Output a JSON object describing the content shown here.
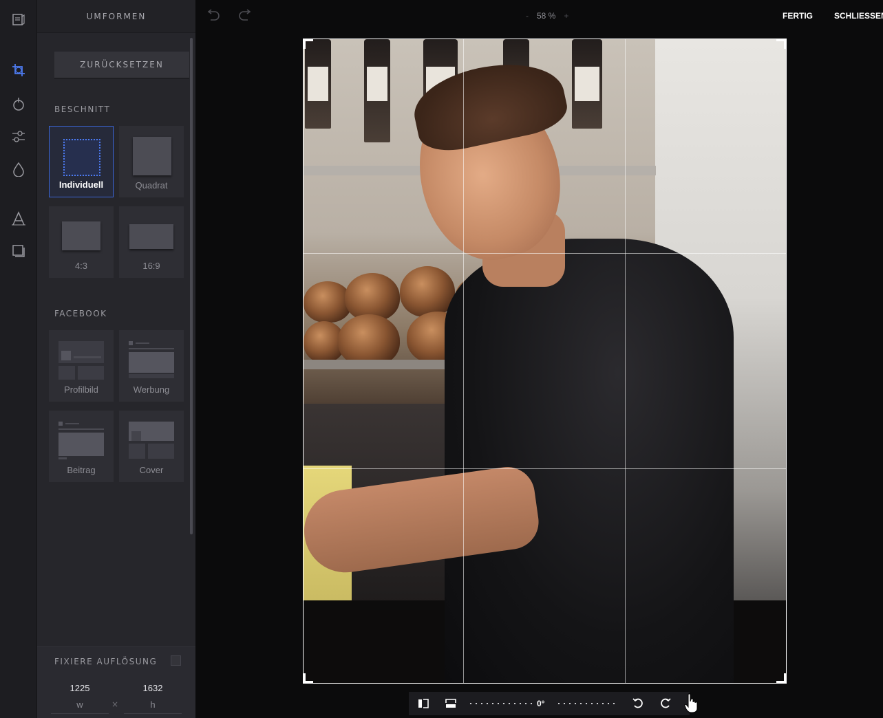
{
  "rail": {
    "icons": [
      "library-icon",
      "crop-icon",
      "filter-icon",
      "adjust-icon",
      "drop-icon",
      "text-icon",
      "frame-icon"
    ]
  },
  "panel": {
    "title": "UMFORMEN",
    "reset_label": "ZURÜCKSETZEN",
    "crop_section": "BESCHNITT",
    "crop_presets": [
      {
        "label": "Individuell",
        "selected": true
      },
      {
        "label": "Quadrat"
      },
      {
        "label": "4:3"
      },
      {
        "label": "16:9"
      }
    ],
    "facebook_section": "FACEBOOK",
    "facebook_presets": [
      {
        "label": "Profilbild"
      },
      {
        "label": "Werbung"
      },
      {
        "label": "Beitrag"
      },
      {
        "label": "Cover"
      }
    ],
    "fix_resolution_label": "FIXIERE AUFLÖSUNG",
    "fix_resolution_checked": false,
    "width_value": "1225",
    "width_unit": "w",
    "height_value": "1632",
    "height_unit": "h",
    "times_symbol": "×"
  },
  "topbar": {
    "zoom_minus": "-",
    "zoom_value": "58 %",
    "zoom_plus": "+",
    "done_label": "FERTIG",
    "close_label": "SCHLIESSEN"
  },
  "bottombar": {
    "angle": "0°"
  },
  "colors": {
    "accent": "#3b66d8",
    "panel_bg": "#26262b",
    "rail_bg": "#1d1d21",
    "canvas_bg": "#0b0b0c"
  }
}
